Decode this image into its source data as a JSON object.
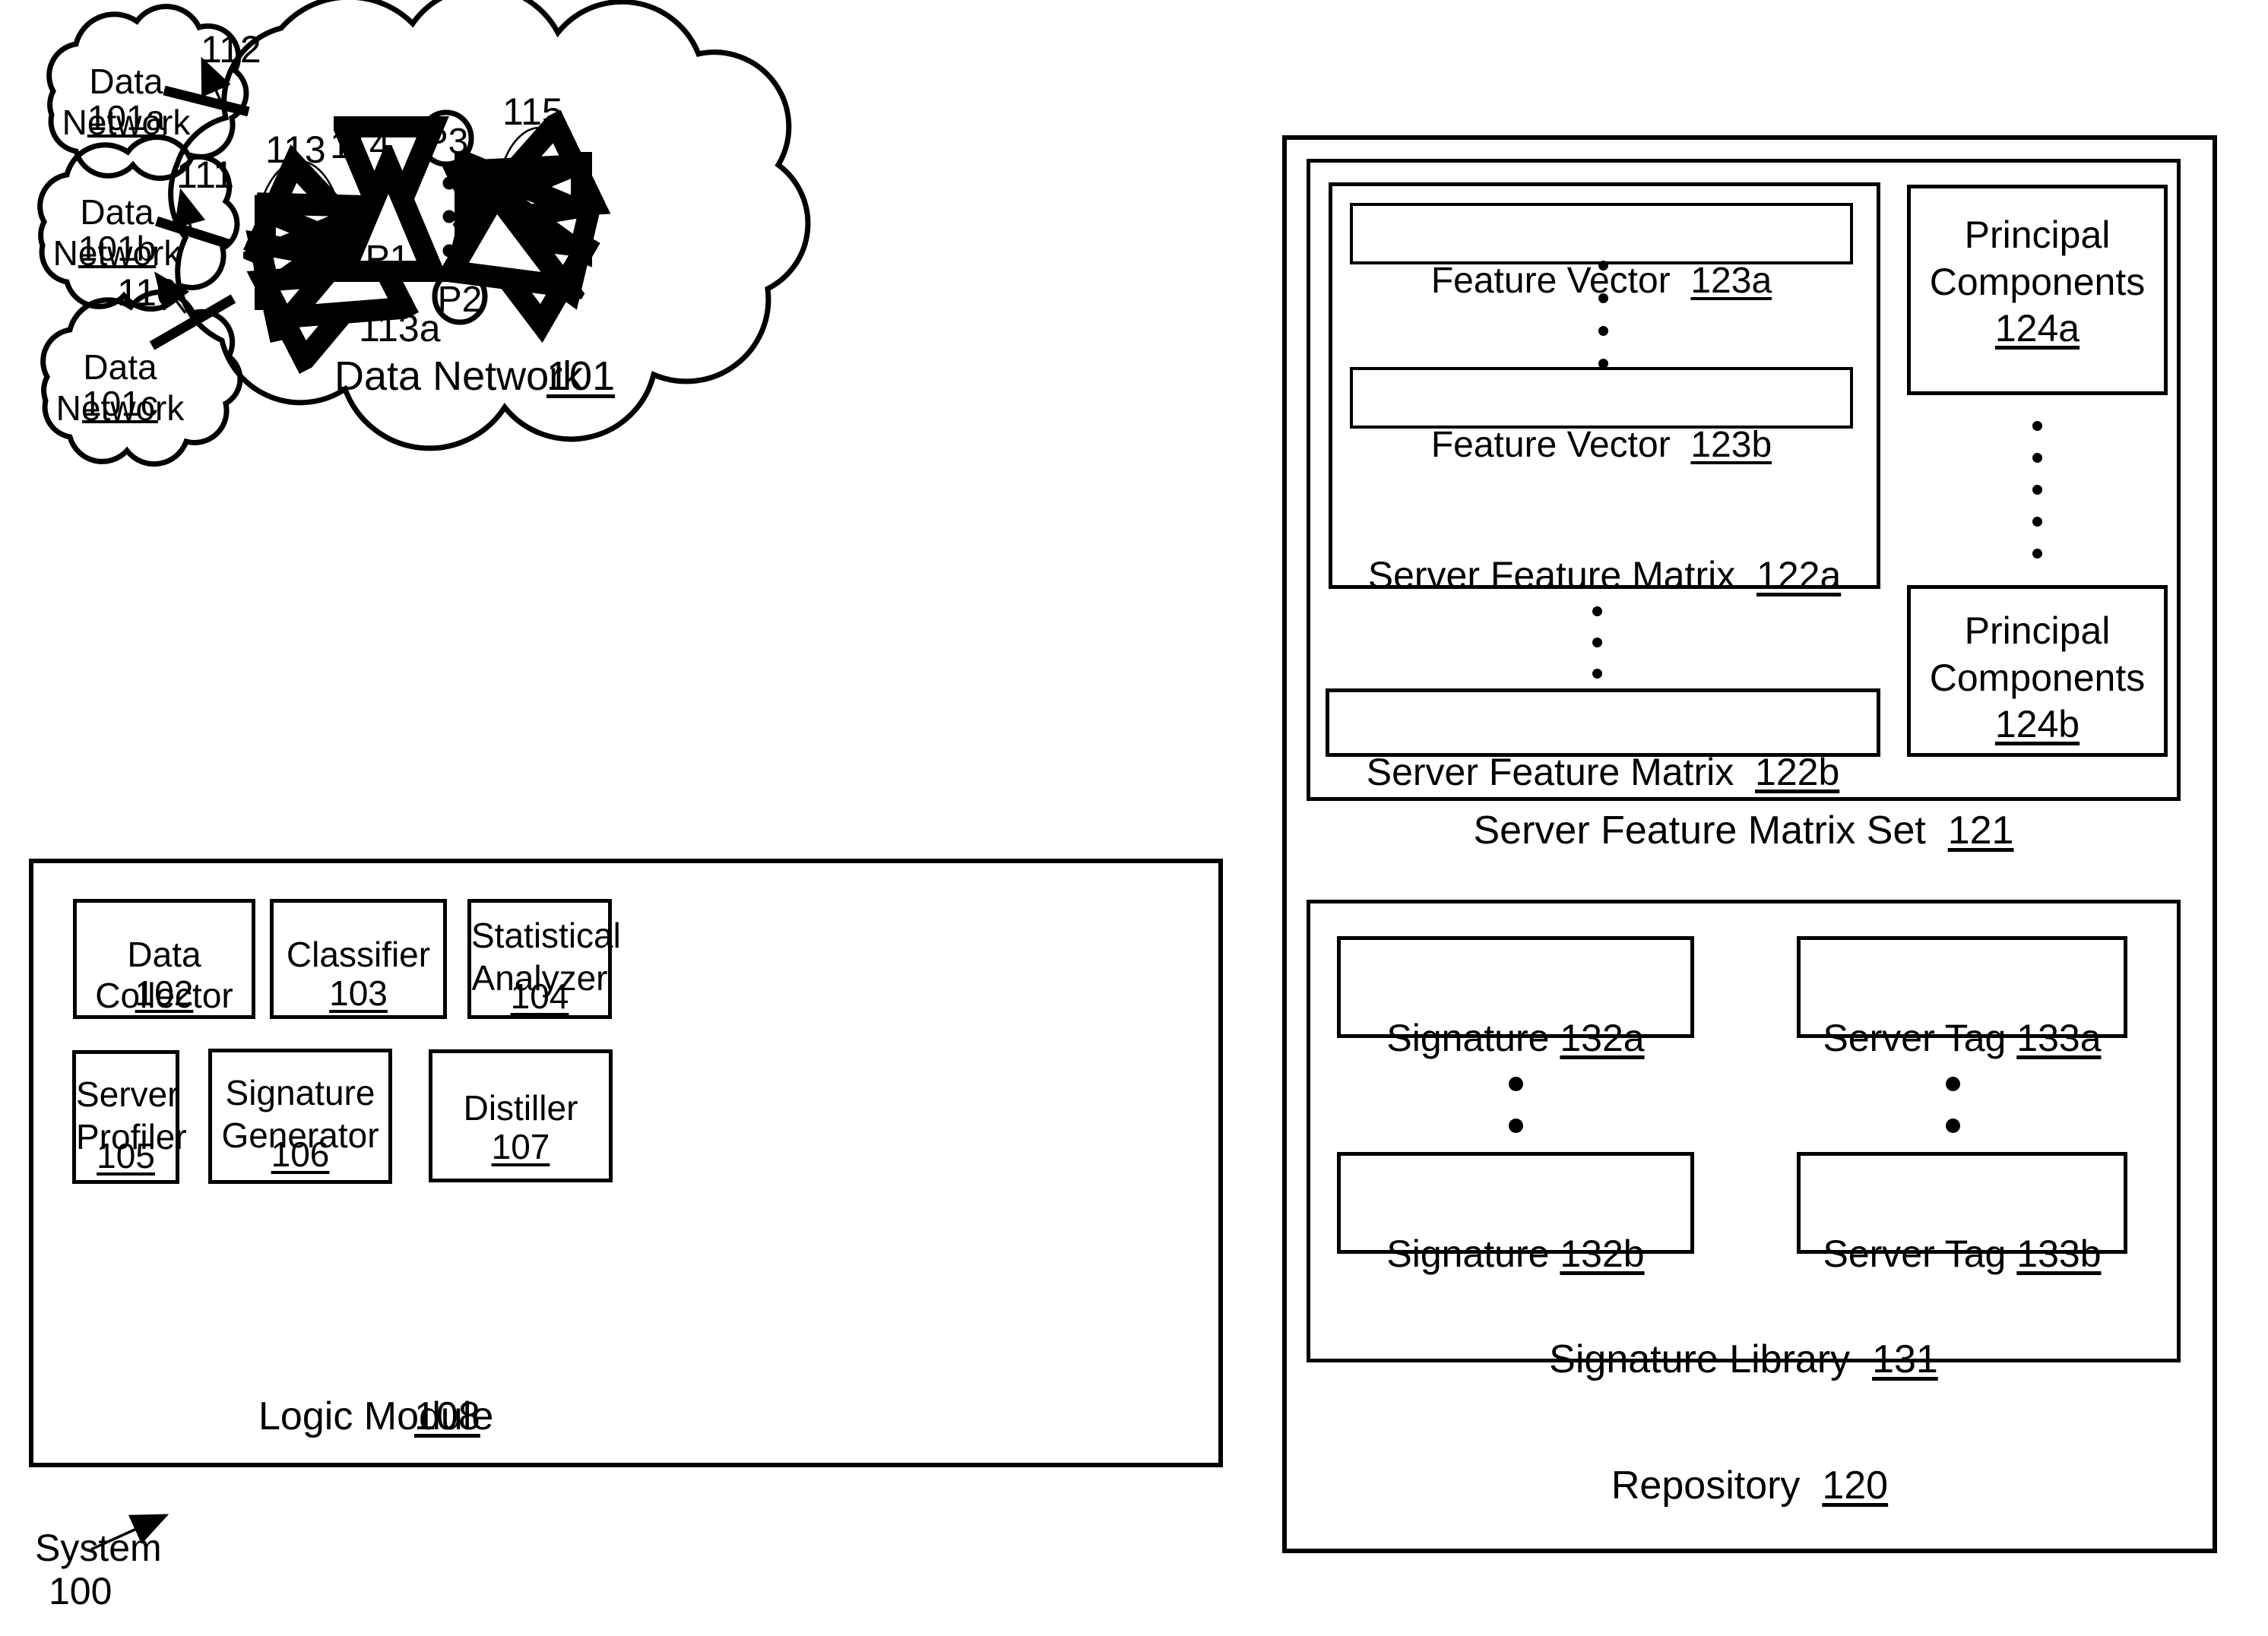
{
  "figure": {
    "system_label_line1": "System",
    "system_label_line2": "100"
  },
  "clouds": {
    "external": [
      {
        "title": "Data\nNetwork",
        "ref": "101a"
      },
      {
        "title": "Data\nNetwork",
        "ref": "101b"
      },
      {
        "title": "Data\nNetwork",
        "ref": "101c"
      }
    ],
    "main": {
      "title": "Data Network",
      "ref": "101"
    }
  },
  "network": {
    "nodes": [
      {
        "label": "P1"
      },
      {
        "label": "P2"
      },
      {
        "label": "P3"
      }
    ],
    "callouts": [
      {
        "ref": "110"
      },
      {
        "ref": "111"
      },
      {
        "ref": "112"
      },
      {
        "ref": "113"
      },
      {
        "ref": "113a"
      },
      {
        "ref": "114"
      },
      {
        "ref": "115"
      }
    ]
  },
  "logic_module": {
    "title": "Logic Module",
    "ref": "108",
    "components": [
      {
        "name": "Data Collector",
        "ref": "102"
      },
      {
        "name": "Classifier",
        "ref": "103"
      },
      {
        "name": "Statistical\nAnalyzer",
        "ref": "104"
      },
      {
        "name": "Server\nProfiler",
        "ref": "105"
      },
      {
        "name": "Signature\nGenerator",
        "ref": "106"
      },
      {
        "name": "Distiller",
        "ref": "107"
      }
    ]
  },
  "repository": {
    "title": "Repository",
    "ref": "120",
    "feature_matrix_set": {
      "title": "Server Feature Matrix Set",
      "ref": "121",
      "matrices": [
        {
          "title": "Server Feature Matrix",
          "ref": "122a",
          "feature_vectors": [
            {
              "title": "Feature Vector",
              "ref": "123a"
            },
            {
              "title": "Feature Vector",
              "ref": "123b"
            }
          ]
        },
        {
          "title": "Server Feature Matrix",
          "ref": "122b"
        }
      ],
      "principal_components": [
        {
          "title": "Principal\nComponents",
          "ref": "124a"
        },
        {
          "title": "Principal\nComponents",
          "ref": "124b"
        }
      ]
    },
    "signature_library": {
      "title": "Signature Library",
      "ref": "131",
      "signatures": [
        {
          "title": "Signature",
          "ref": "132a"
        },
        {
          "title": "Signature",
          "ref": "132b"
        }
      ],
      "server_tags": [
        {
          "title": "Server Tag",
          "ref": "133a"
        },
        {
          "title": "Server Tag",
          "ref": "133b"
        }
      ]
    }
  }
}
